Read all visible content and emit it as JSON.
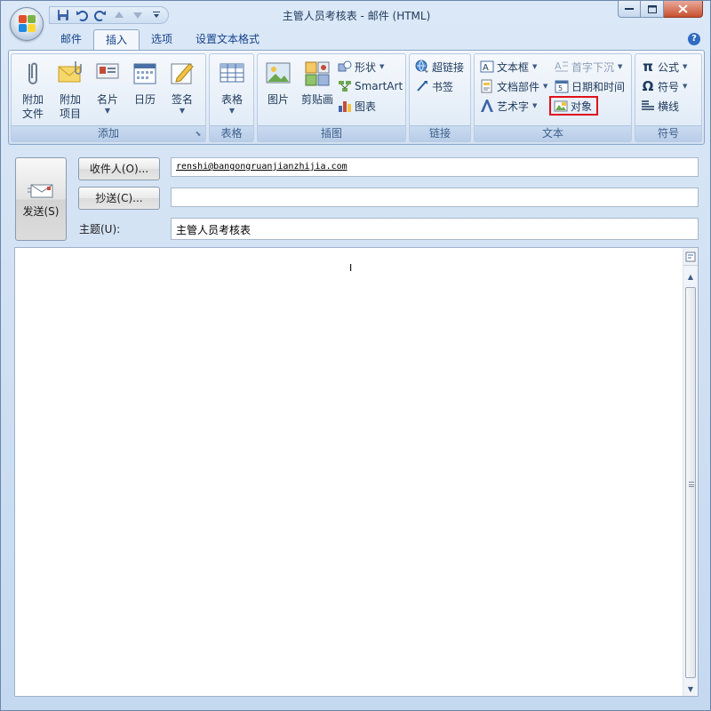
{
  "window": {
    "title": "主管人员考核表 - 邮件 (HTML)"
  },
  "quick_access": {
    "icons": [
      "save-icon",
      "undo-icon",
      "redo-icon",
      "up-arrow-icon",
      "down-arrow-icon",
      "customize-dropdown-icon"
    ]
  },
  "tabs": [
    {
      "label": "邮件",
      "active": false
    },
    {
      "label": "插入",
      "active": true
    },
    {
      "label": "选项",
      "active": false
    },
    {
      "label": "设置文本格式",
      "active": false
    }
  ],
  "ribbon": {
    "groups": {
      "add": {
        "label": "添加",
        "attach_file": "附加\n文件",
        "attach_item": "附加\n项目",
        "business_card": "名片",
        "calendar": "日历",
        "signature": "签名"
      },
      "tables": {
        "label": "表格",
        "table": "表格"
      },
      "illustrations": {
        "label": "插图",
        "picture": "图片",
        "clipart": "剪贴画",
        "shapes": "形状",
        "smartart": "SmartArt",
        "chart": "图表"
      },
      "links": {
        "label": "链接",
        "hyperlink": "超链接",
        "bookmark": "书签"
      },
      "text": {
        "label": "文本",
        "textbox": "文本框",
        "quick_parts": "文档部件",
        "wordart": "艺术字",
        "drop_cap": "首字下沉",
        "date_time": "日期和时间",
        "object": "对象"
      },
      "symbols": {
        "label": "符号",
        "equation": "公式",
        "symbol": "符号",
        "horizontal_line": "横线"
      }
    }
  },
  "compose": {
    "send_label": "发送(S)",
    "to_button": "收件人(O)...",
    "cc_button": "抄送(C)...",
    "to_value": "renshi@bangongruanjianzhijia.com",
    "cc_value": "",
    "subject_label": "主题(U):",
    "subject_value": "主管人员考核表"
  },
  "colors": {
    "highlight_border": "#e0101a",
    "accent": "#15428b"
  }
}
